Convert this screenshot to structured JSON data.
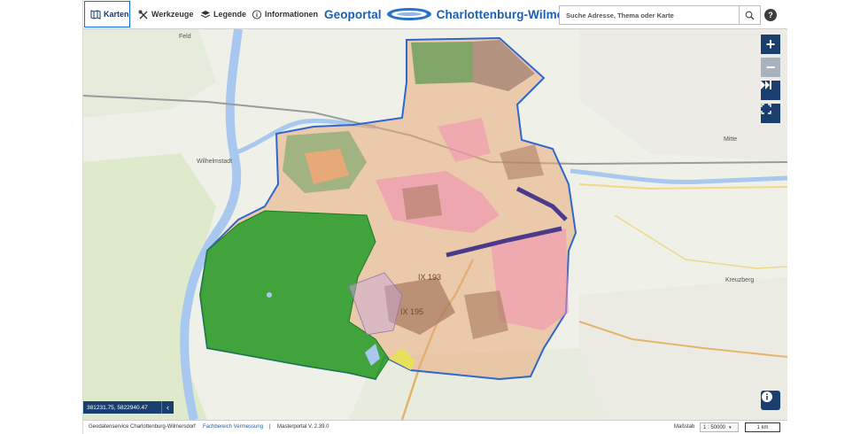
{
  "menu": {
    "karten": "Karten",
    "werkzeuge": "Werkzeuge",
    "legende": "Legende",
    "informationen": "Informationen"
  },
  "header": {
    "logo_left": "Geoportal",
    "logo_right": "Charlottenburg-Wilmersdorf"
  },
  "search": {
    "placeholder": "Suche Adresse, Thema oder Karte"
  },
  "help": {
    "label": "?"
  },
  "map": {
    "labels": {
      "feld": "Feld",
      "wilhelmstadt": "Wilhelmstadt",
      "mitte": "Mitte",
      "kreuzberg": "Kreuzberg",
      "plot_193": "IX 193",
      "plot_195": "IX 195"
    },
    "controls": {
      "zoom_in": "+",
      "zoom_out": "−"
    },
    "coordinates": "381231.75, 5822940.47"
  },
  "footer": {
    "service": "Geodatenservice Charlottenburg-Wilmersdorf",
    "link": "Fachbereich Vermessung",
    "separator": "|",
    "version": "Masterportal V. 2.39.0",
    "scale_label": "Maßstab",
    "scale_value": "1 : 50000",
    "scalebar": "1 km"
  },
  "colors": {
    "accent": "#1a3e6e",
    "brand": "#1c5fae",
    "forest": "#2f9e2f",
    "district_border": "#2f66d0"
  }
}
